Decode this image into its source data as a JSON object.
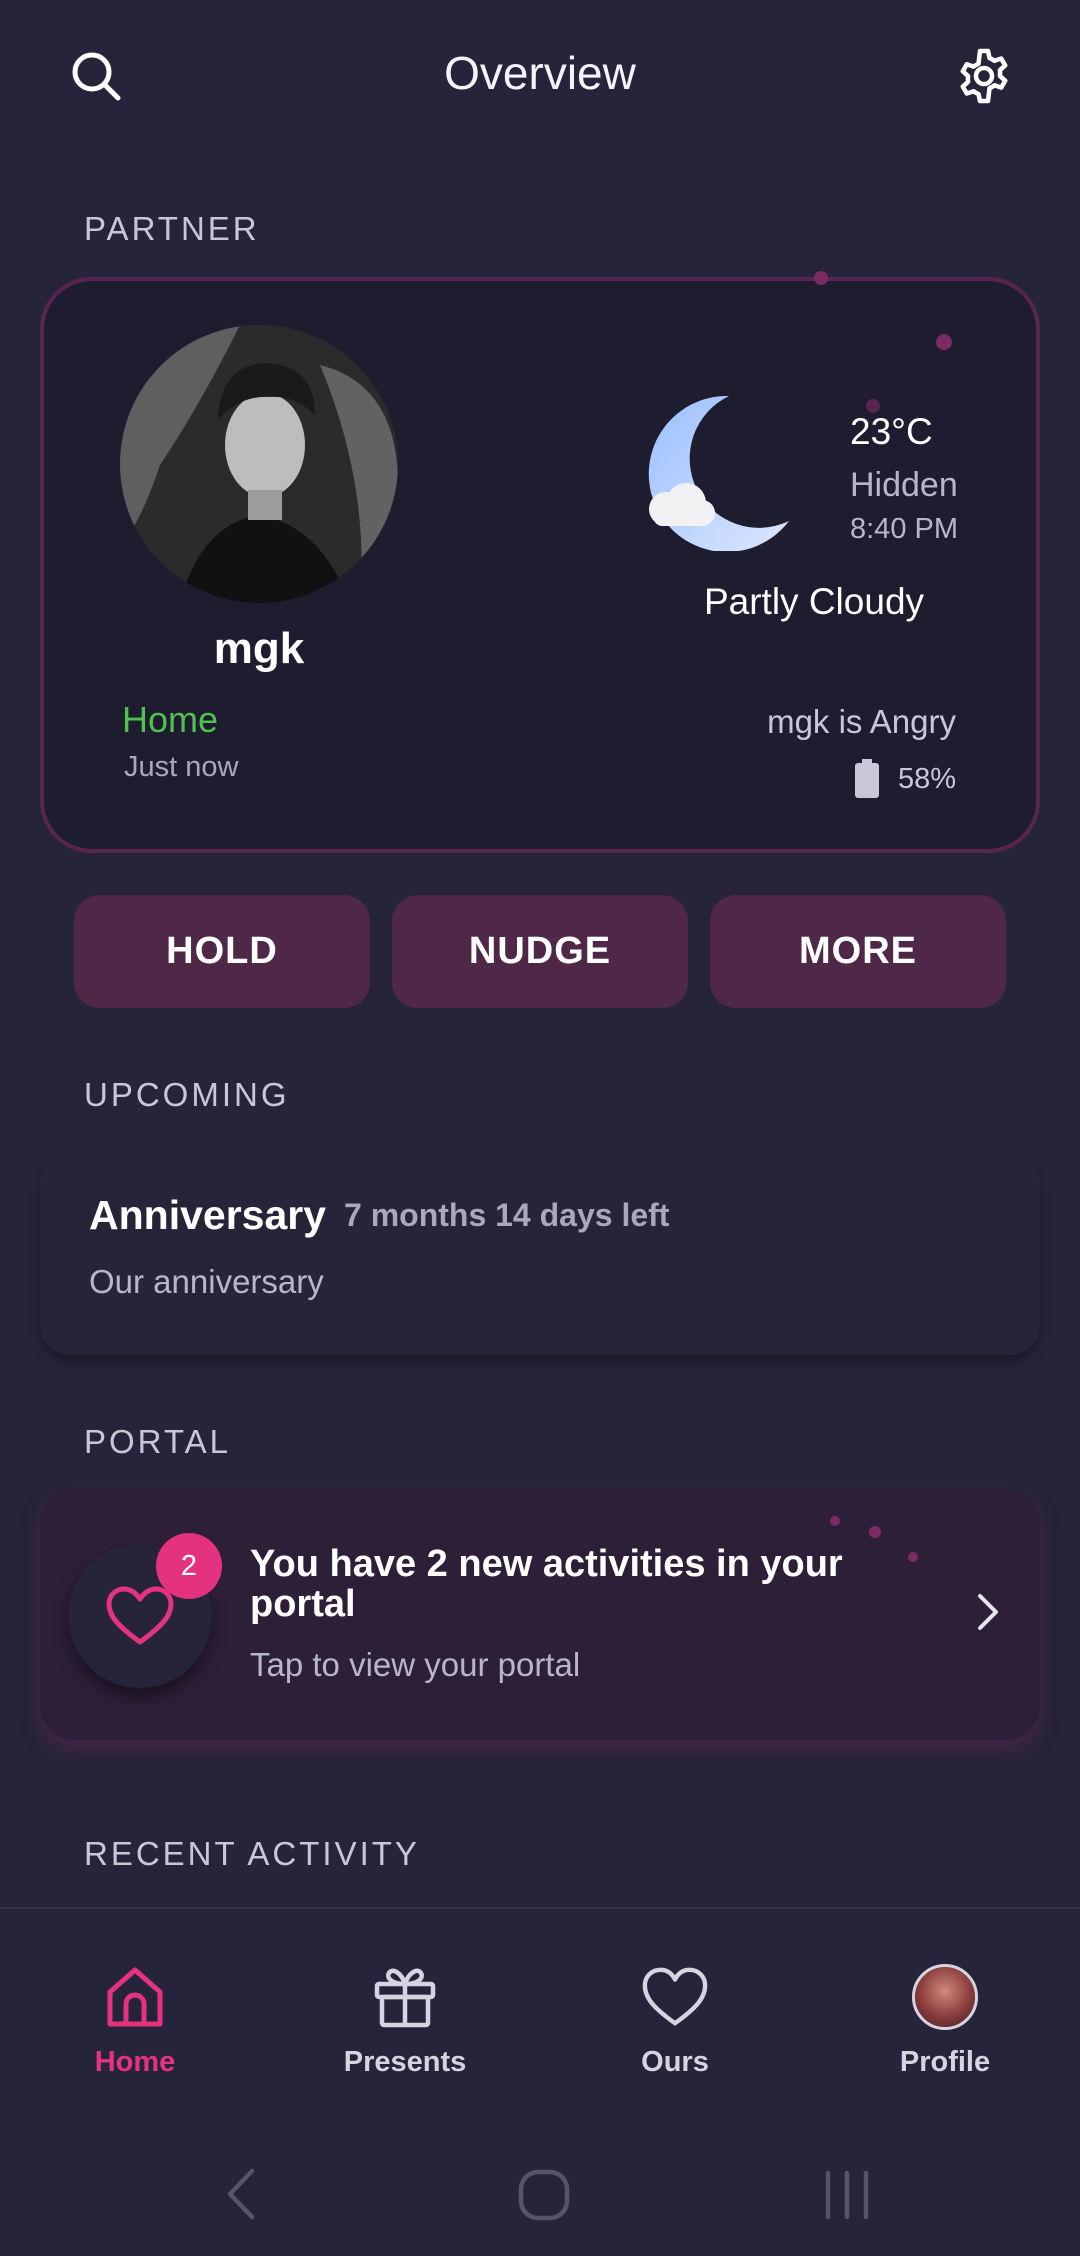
{
  "header": {
    "title": "Overview",
    "search_icon": "search-icon",
    "settings_icon": "gear-icon"
  },
  "sections": {
    "partner": "PARTNER",
    "upcoming": "UPCOMING",
    "portal": "PORTAL",
    "recent": "RECENT ACTIVITY"
  },
  "partner": {
    "name": "mgk",
    "location": "Home",
    "location_time": "Just now",
    "mood": "mgk is Angry",
    "battery": "58%",
    "location_color": "#4fc14f"
  },
  "weather": {
    "temperature": "23°C",
    "visibility": "Hidden",
    "time": "8:40 PM",
    "condition": "Partly Cloudy",
    "icon": "moon-cloud-icon"
  },
  "actions": {
    "hold": "HOLD",
    "nudge": "NUDGE",
    "more": "MORE"
  },
  "upcoming": {
    "title": "Anniversary",
    "time_left": "7 months 14 days left",
    "description": "Our anniversary"
  },
  "portal": {
    "badge": "2",
    "title": "You have 2 new activities in your portal",
    "subtitle": "Tap to view your portal"
  },
  "nav": {
    "home": "Home",
    "presents": "Presents",
    "ours": "Ours",
    "profile": "Profile"
  },
  "colors": {
    "accent": "#e5327f",
    "background": "#25243a",
    "button": "#4f2848"
  }
}
